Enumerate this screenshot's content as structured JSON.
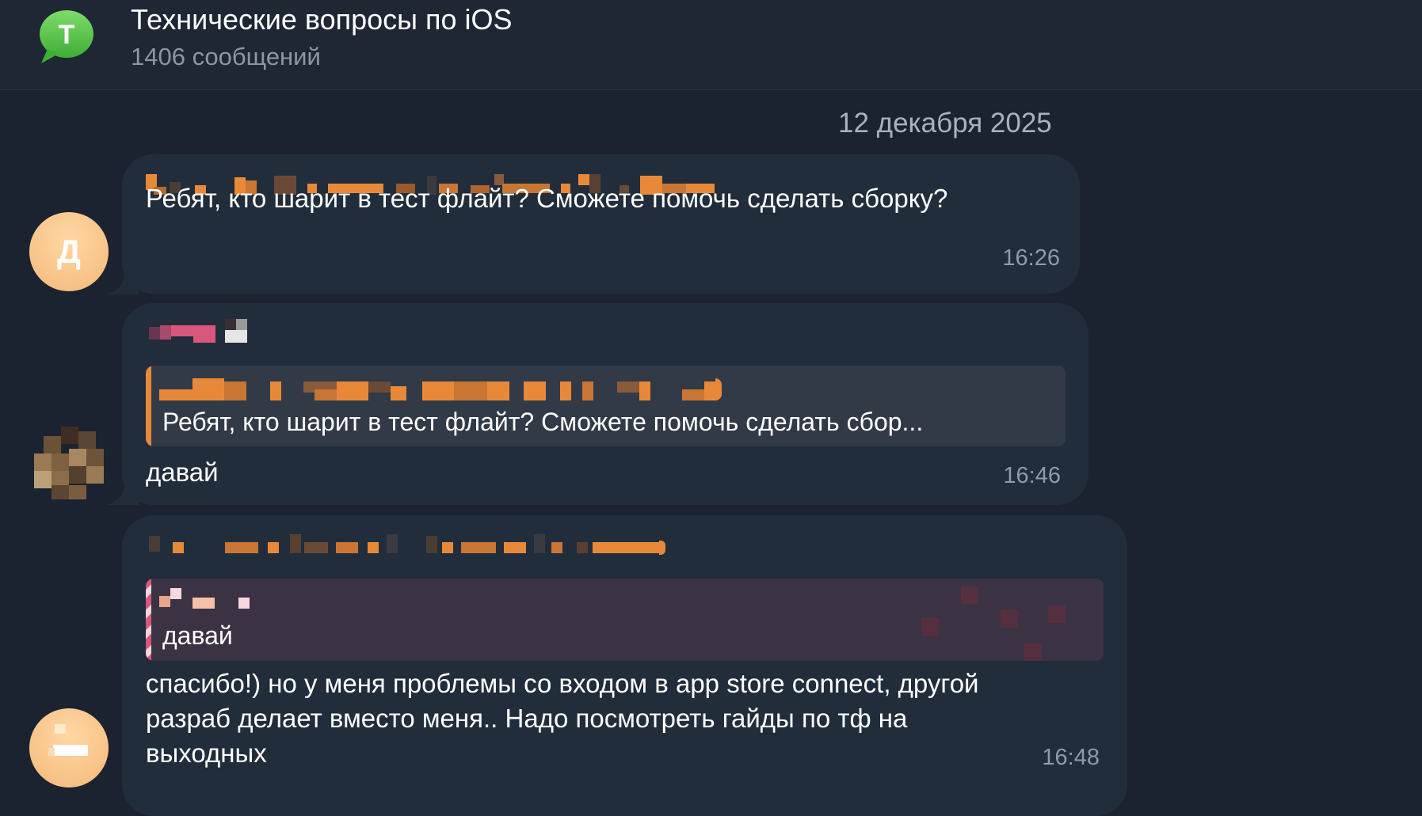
{
  "header": {
    "chat_icon": "speech-bubble-icon",
    "chat_icon_letter": "Т",
    "title": "Технические вопросы по iOS",
    "subtitle": "1406 сообщений"
  },
  "date_separator": "12 декабря 2025",
  "messages": [
    {
      "avatar_letter": "Д",
      "text": "Ребят, кто шарит в тест флайт? Сможете помочь сделать сборку?",
      "time": "16:26"
    },
    {
      "reply_text": "Ребят, кто шарит в тест флайт? Сможете помочь сделать сбор...",
      "text": "давай",
      "time": "16:46"
    },
    {
      "reply_text": "давай",
      "text_lines": [
        "спасибо!) но у меня проблемы со входом в app store connect, другой",
        "разраб делает вместо меня.. Надо посмотреть гайды по тф на",
        "выходных"
      ],
      "time": "16:48"
    }
  ],
  "colors": {
    "background": "#1b2330",
    "bubble": "#212d3b",
    "accent_orange": "#e8893a",
    "accent_pink": "#d9577c",
    "time_text": "#8e9aa8"
  }
}
